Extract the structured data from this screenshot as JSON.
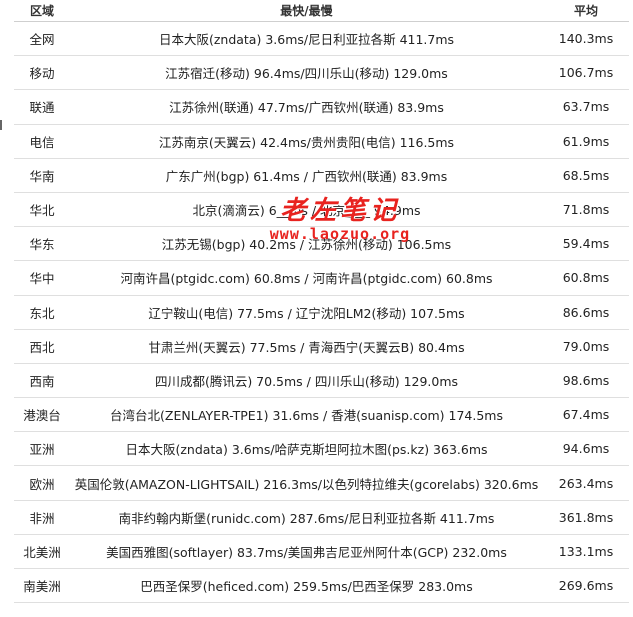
{
  "headers": {
    "region": "区域",
    "fastest_slowest": "最快/最慢",
    "average": "平均"
  },
  "rows": [
    {
      "region": "全网",
      "detail": "日本大阪(zndata) 3.6ms/尼日利亚拉各斯 411.7ms",
      "avg": "140.3ms"
    },
    {
      "region": "移动",
      "detail": "江苏宿迁(移动) 96.4ms/四川乐山(移动) 129.0ms",
      "avg": "106.7ms"
    },
    {
      "region": "联通",
      "detail": "江苏徐州(联通) 47.7ms/广西钦州(联通) 83.9ms",
      "avg": "63.7ms"
    },
    {
      "region": "电信",
      "detail": "江苏南京(天翼云) 42.4ms/贵州贵阳(电信) 116.5ms",
      "avg": "61.9ms"
    },
    {
      "region": "华南",
      "detail": "广东广州(bgp) 61.4ms / 广西钦州(联通) 83.9ms",
      "avg": "68.5ms"
    },
    {
      "region": "华北",
      "detail": "北京(滴滴云) 6__ms / 北京____ 94.9ms",
      "avg": "71.8ms"
    },
    {
      "region": "华东",
      "detail": "江苏无锡(bgp) 40.2ms / 江苏徐州(移动) 106.5ms",
      "avg": "59.4ms"
    },
    {
      "region": "华中",
      "detail": "河南许昌(ptgidc.com) 60.8ms / 河南许昌(ptgidc.com) 60.8ms",
      "avg": "60.8ms"
    },
    {
      "region": "东北",
      "detail": "辽宁鞍山(电信) 77.5ms / 辽宁沈阳LM2(移动) 107.5ms",
      "avg": "86.6ms"
    },
    {
      "region": "西北",
      "detail": "甘肃兰州(天翼云) 77.5ms / 青海西宁(天翼云B) 80.4ms",
      "avg": "79.0ms"
    },
    {
      "region": "西南",
      "detail": "四川成都(腾讯云) 70.5ms / 四川乐山(移动) 129.0ms",
      "avg": "98.6ms"
    },
    {
      "region": "港澳台",
      "detail": "台湾台北(ZENLAYER-TPE1) 31.6ms / 香港(suanisp.com) 174.5ms",
      "avg": "67.4ms"
    },
    {
      "region": "亚洲",
      "detail": "日本大阪(zndata) 3.6ms/哈萨克斯坦阿拉木图(ps.kz) 363.6ms",
      "avg": "94.6ms"
    },
    {
      "region": "欧洲",
      "detail": "英国伦敦(AMAZON-LIGHTSAIL) 216.3ms/以色列特拉维夫(gcorelabs) 320.6ms",
      "avg": "263.4ms"
    },
    {
      "region": "非洲",
      "detail": "南非约翰内斯堡(runidc.com) 287.6ms/尼日利亚拉各斯 411.7ms",
      "avg": "361.8ms"
    },
    {
      "region": "北美洲",
      "detail": "美国西雅图(softlayer) 83.7ms/美国弗吉尼亚州阿什本(GCP) 232.0ms",
      "avg": "133.1ms"
    },
    {
      "region": "南美洲",
      "detail": "巴西圣保罗(heficed.com) 259.5ms/巴西圣保罗 283.0ms",
      "avg": "269.6ms"
    }
  ],
  "watermark": {
    "title": "老左笔记",
    "url": "www.laozuo.org"
  }
}
